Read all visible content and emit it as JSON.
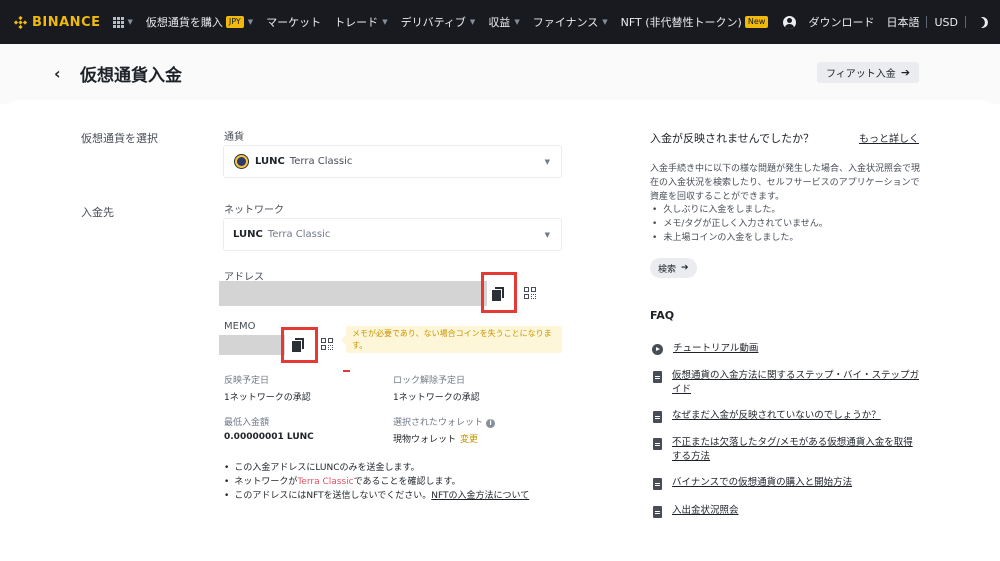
{
  "nav": {
    "logo": "BINANCE",
    "items": [
      {
        "label": "仮想通貨を購入",
        "badge": "JPY",
        "caret": true
      },
      {
        "label": "マーケット",
        "caret": false
      },
      {
        "label": "トレード",
        "caret": true
      },
      {
        "label": "デリバティブ",
        "caret": true
      },
      {
        "label": "収益",
        "caret": true
      },
      {
        "label": "ファイナンス",
        "caret": true
      },
      {
        "label": "NFT (非代替性トークン)",
        "badge": "New",
        "caret": false
      }
    ],
    "download": "ダウンロード",
    "language": "日本語",
    "currency": "USD"
  },
  "header": {
    "back": "‹",
    "title": "仮想通貨入金",
    "fiat_button": "フィアット入金"
  },
  "form": {
    "select_coin_label": "仮想通貨を選択",
    "currency_label": "通貨",
    "coin_symbol": "LUNC",
    "coin_name": "Terra Classic",
    "deposit_to_label": "入金先",
    "network_label": "ネットワーク",
    "network_symbol": "LUNC",
    "network_name": "Terra Classic",
    "address_label": "アドレス",
    "memo_label": "MEMO",
    "memo_note": "メモが必要であり、ない場合コインを失うことになります。"
  },
  "info": {
    "reflect_label": "反映予定日",
    "reflect_value": "1ネットワークの承認",
    "unlock_label": "ロック解除予定日",
    "unlock_value": "1ネットワークの承認",
    "min_label": "最低入金額",
    "min_value": "0.00000001 LUNC",
    "wallet_label": "選択されたウォレット",
    "wallet_value": "現物ウォレット",
    "wallet_change": "変更"
  },
  "notes": {
    "line1": "この入金アドレスにLUNCのみを送金します。",
    "line2_pre": "ネットワークが",
    "line2_link": "Terra Classic",
    "line2_post": "であることを確認します。",
    "line3_pre": "このアドレスにはNFTを送信しないでください。",
    "line3_link": "NFTの入金方法について"
  },
  "help": {
    "title": "入金が反映されませんでしたか？",
    "more": "もっと詳しく",
    "paragraph": "入金手続き中に以下の様な問題が発生した場合、入金状況照会で現在の入金状況を検索したり、セルフサービスのアプリケーションで資産を回収することができます。",
    "items": [
      "久しぶりに入金をしました。",
      "メモ/タグが正しく入力されていません。",
      "未上場コインの入金をしました。"
    ],
    "search_button": "検索"
  },
  "faq": {
    "title": "FAQ",
    "items": [
      {
        "icon": "play-icon",
        "text": "チュートリアル動画"
      },
      {
        "icon": "document-icon",
        "text": "仮想通貨の入金方法に関するステップ・バイ・ステップガイド"
      },
      {
        "icon": "document-icon",
        "text": "なぜまだ入金が反映されていないのでしょうか？"
      },
      {
        "icon": "document-icon",
        "text": "不正または欠落したタグ/メモがある仮想通貨入金を取得する方法"
      },
      {
        "icon": "document-icon",
        "text": "バイナンスでの仮想通貨の購入と開始方法"
      },
      {
        "icon": "document-icon",
        "text": "入出金状況照会"
      }
    ]
  }
}
